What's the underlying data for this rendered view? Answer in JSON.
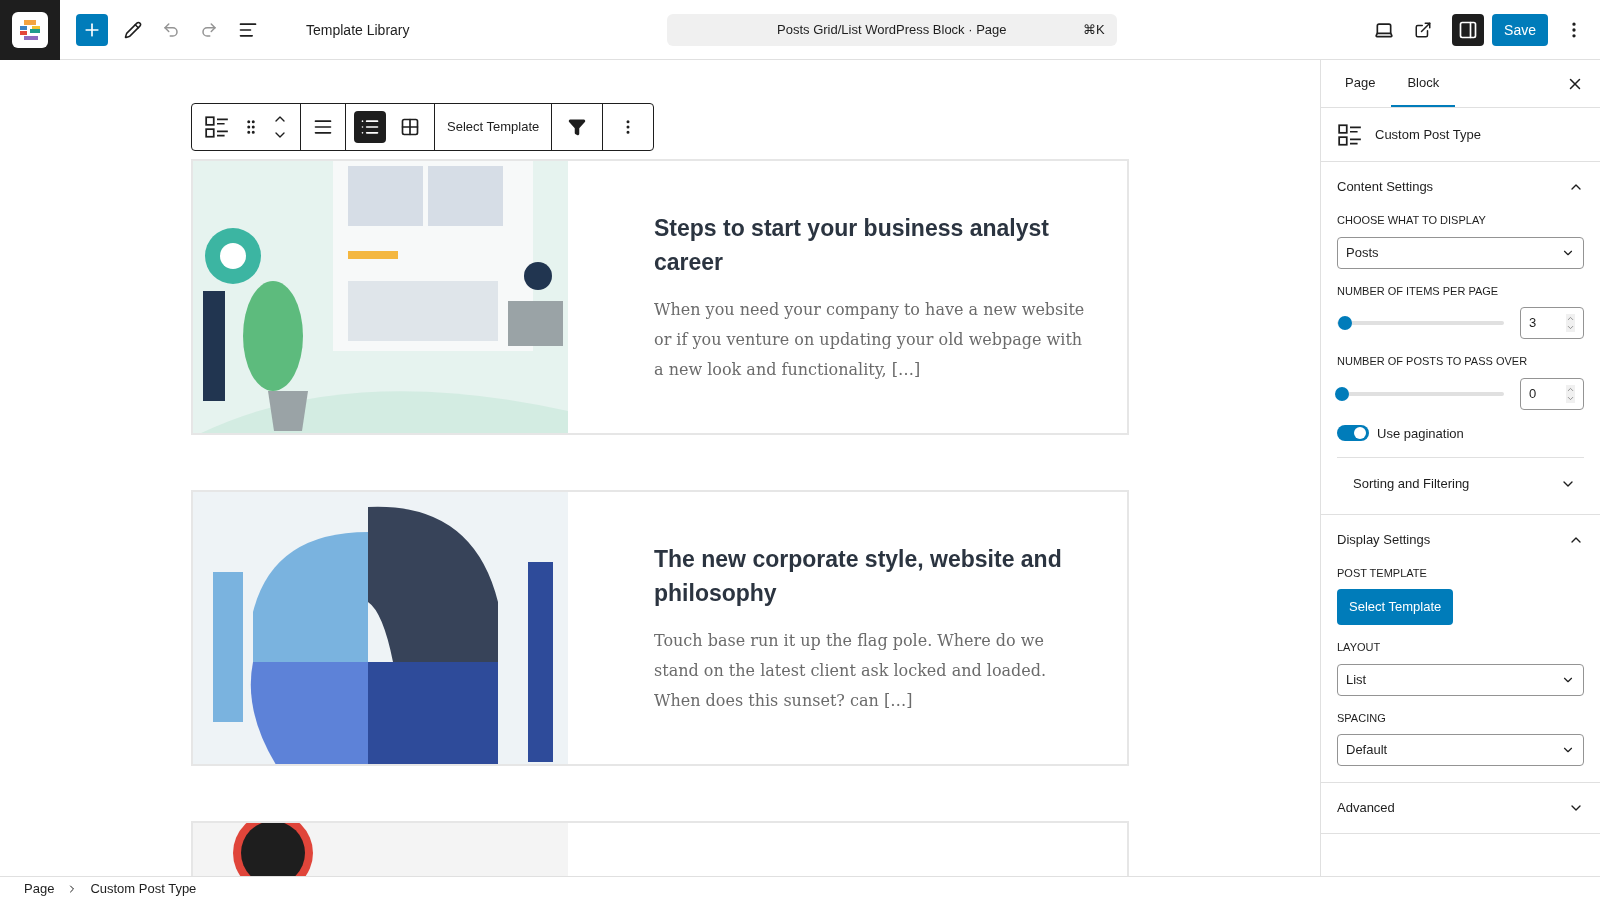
{
  "topbar": {
    "title": "Template Library",
    "command": {
      "label": "Posts Grid/List WordPress Block · Page",
      "shortcut": "⌘K"
    },
    "save": "Save",
    "sidebar_toggle_on": true
  },
  "block_toolbar": {
    "layouts": [
      {
        "kind": "list",
        "selected": true
      },
      {
        "kind": "grid",
        "selected": false
      }
    ],
    "select_template": "Select Template"
  },
  "posts": [
    {
      "title": "Steps to start your business analyst career",
      "excerpt": "When you need your company to have a new website or if you venture on updating your old webpage with a new look and functionality, […]"
    },
    {
      "title": "The new corporate style, website and philosophy",
      "excerpt": "Touch base run it up the flag pole. Where do we stand on the latest client ask locked and loaded. When does this sunset? can […]"
    }
  ],
  "sidebar": {
    "tabs": [
      {
        "label": "Page",
        "selected": false
      },
      {
        "label": "Block",
        "selected": true
      }
    ],
    "block_name": "Custom Post Type",
    "panels": [
      {
        "title": "Content Settings",
        "expanded": true,
        "fields": [
          {
            "kind": "select",
            "label": "CHOOSE WHAT TO DISPLAY",
            "value": "Posts"
          },
          {
            "kind": "range",
            "label": "NUMBER OF ITEMS PER PAGE",
            "level": 0.02,
            "value": "3"
          },
          {
            "kind": "range",
            "label": "NUMBER OF POSTS TO PASS OVER",
            "level": 0,
            "value": "0"
          },
          {
            "kind": "toggle",
            "label": "Use pagination",
            "on": true
          },
          {
            "kind": "subpanel",
            "label": "Sorting and Filtering",
            "expanded": false
          }
        ]
      },
      {
        "title": "Display Settings",
        "expanded": true,
        "fields": [
          {
            "kind": "button",
            "label": "POST TEMPLATE",
            "value": "Select Template"
          },
          {
            "kind": "select",
            "label": "LAYOUT",
            "value": "List"
          },
          {
            "kind": "select",
            "label": "SPACING",
            "value": "Default"
          }
        ]
      },
      {
        "title": "Advanced",
        "expanded": false
      }
    ]
  },
  "breadcrumb": [
    "Page",
    "Custom Post Type"
  ]
}
